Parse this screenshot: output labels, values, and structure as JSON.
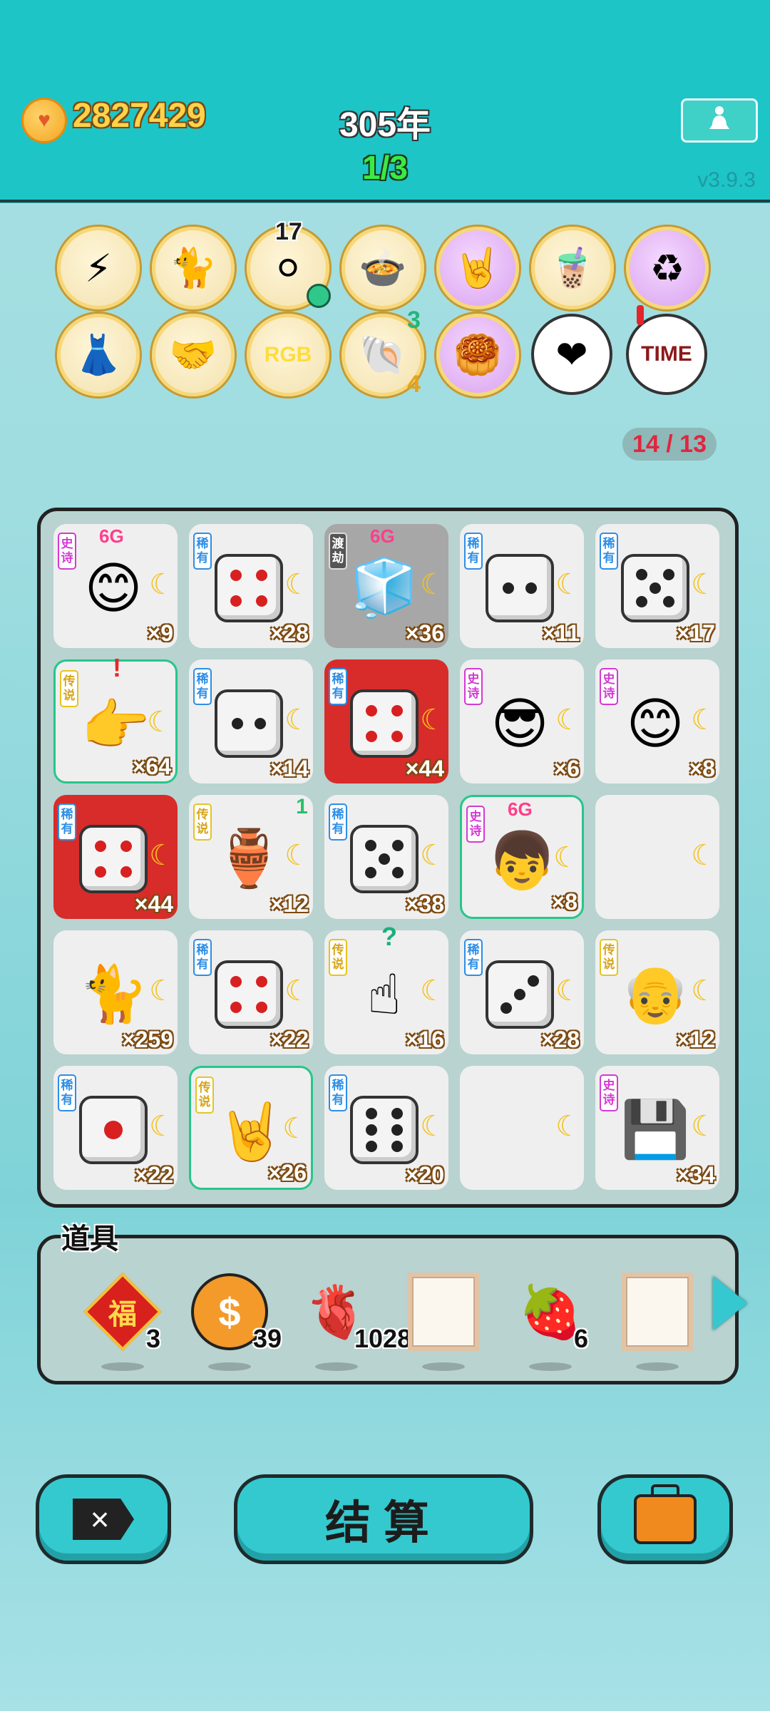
{
  "header": {
    "coins": "2827429",
    "year": "305年",
    "stage": "1/3",
    "version": "v3.9.3"
  },
  "relics": [
    {
      "icon": "lightning-icon",
      "glyph": "⚡"
    },
    {
      "icon": "cat-icon",
      "glyph": "🐈"
    },
    {
      "icon": "dice-tray-icon",
      "glyph": "⚪",
      "number": "17"
    },
    {
      "icon": "fried-rice-icon",
      "glyph": "🍲"
    },
    {
      "icon": "rock-hand-icon",
      "glyph": "🤘"
    },
    {
      "icon": "milk-tea-icon",
      "glyph": "🧋"
    },
    {
      "icon": "recycle-icon",
      "glyph": "♻"
    },
    {
      "icon": "skirt-icon",
      "glyph": "👗"
    },
    {
      "icon": "handshake-icon",
      "glyph": "🤝"
    },
    {
      "icon": "rgb-icon",
      "text": "RGB"
    },
    {
      "icon": "shell-icon",
      "glyph": "🐚",
      "top_number": "3",
      "bottom_number": "4"
    },
    {
      "icon": "mooncake-icon",
      "glyph": "🥮"
    },
    {
      "icon": "heart-cup-icon",
      "glyph": "❤"
    },
    {
      "icon": "time-magazine-icon",
      "text": "TIME"
    }
  ],
  "relic_counter": "14 / 13",
  "board": {
    "cells": [
      {
        "tag": "史诗",
        "tag_type": "epic",
        "art": "egg-face",
        "count": "×9",
        "badge": "6G"
      },
      {
        "tag": "稀有",
        "tag_type": "rare",
        "art": "dice4-red",
        "count": "×28"
      },
      {
        "tag": "渡劫",
        "tag_type": "dark",
        "art": "fridge",
        "count": "×36",
        "badge": "6G",
        "bg": "gray"
      },
      {
        "tag": "稀有",
        "tag_type": "rare",
        "art": "dice2",
        "count": "×11"
      },
      {
        "tag": "稀有",
        "tag_type": "rare",
        "art": "dice5",
        "count": "×17"
      },
      {
        "tag": "传说",
        "tag_type": "legend",
        "art": "pointing-hand",
        "count": "×64",
        "mark": "!",
        "highlight": true
      },
      {
        "tag": "稀有",
        "tag_type": "rare",
        "art": "dice2",
        "count": "×14"
      },
      {
        "tag": "稀有",
        "tag_type": "rare",
        "art": "dice4-red",
        "count": "×44",
        "bg": "red"
      },
      {
        "tag": "史诗",
        "tag_type": "epic",
        "art": "sunglasses-man",
        "count": "×6"
      },
      {
        "tag": "史诗",
        "tag_type": "epic",
        "art": "egg-face",
        "count": "×8"
      },
      {
        "tag": "稀有",
        "tag_type": "rare",
        "art": "dice4-red",
        "count": "×44",
        "bg": "red"
      },
      {
        "tag": "传说",
        "tag_type": "legend",
        "art": "green-vase",
        "count": "×12",
        "corner": "1"
      },
      {
        "tag": "稀有",
        "tag_type": "rare",
        "art": "dice5",
        "count": "×38"
      },
      {
        "tag": "史诗",
        "tag_type": "epic",
        "art": "cap-boy",
        "count": "×8",
        "badge": "6G",
        "highlight": true
      },
      {
        "tag": "",
        "tag_type": "",
        "art": "",
        "count": ""
      },
      {
        "tag": "",
        "tag_type": "",
        "art": "cat",
        "count": "×259"
      },
      {
        "tag": "稀有",
        "tag_type": "rare",
        "art": "dice4-red",
        "count": "×22"
      },
      {
        "tag": "传说",
        "tag_type": "legend",
        "art": "point-up-hand",
        "count": "×16",
        "mark": "?"
      },
      {
        "tag": "稀有",
        "tag_type": "rare",
        "art": "dice3",
        "count": "×28"
      },
      {
        "tag": "传说",
        "tag_type": "legend",
        "art": "old-man",
        "count": "×12"
      },
      {
        "tag": "稀有",
        "tag_type": "rare",
        "art": "dice1-red",
        "count": "×22"
      },
      {
        "tag": "传说",
        "tag_type": "legend",
        "art": "rock-hand",
        "count": "×26",
        "highlight": true
      },
      {
        "tag": "稀有",
        "tag_type": "rare",
        "art": "dice6",
        "count": "×20"
      },
      {
        "tag": "",
        "tag_type": "",
        "art": "",
        "count": ""
      },
      {
        "tag": "史诗",
        "tag_type": "epic",
        "art": "gpu",
        "count": "×34"
      }
    ]
  },
  "items": {
    "title": "道具",
    "list": [
      {
        "icon": "fu-diamond-icon",
        "glyph": "福",
        "count": "3"
      },
      {
        "icon": "dollar-coin-icon",
        "glyph": "$",
        "count": "39"
      },
      {
        "icon": "liver-icon",
        "glyph": "🫀",
        "count": "1028"
      },
      {
        "icon": "blank-frame-icon",
        "glyph": "",
        "count": ""
      },
      {
        "icon": "strawberry-icon",
        "glyph": "🍓",
        "count": "6"
      },
      {
        "icon": "blank-frame-icon",
        "glyph": "",
        "count": ""
      }
    ]
  },
  "buttons": {
    "delete_icon": "×",
    "settle": "结算"
  },
  "colors": {
    "topbar": "#1dc5c7",
    "coins_text": "#ffd24a",
    "stage_text": "#3bea45",
    "counter_text": "#e0263f",
    "button": "#34c9cf"
  }
}
